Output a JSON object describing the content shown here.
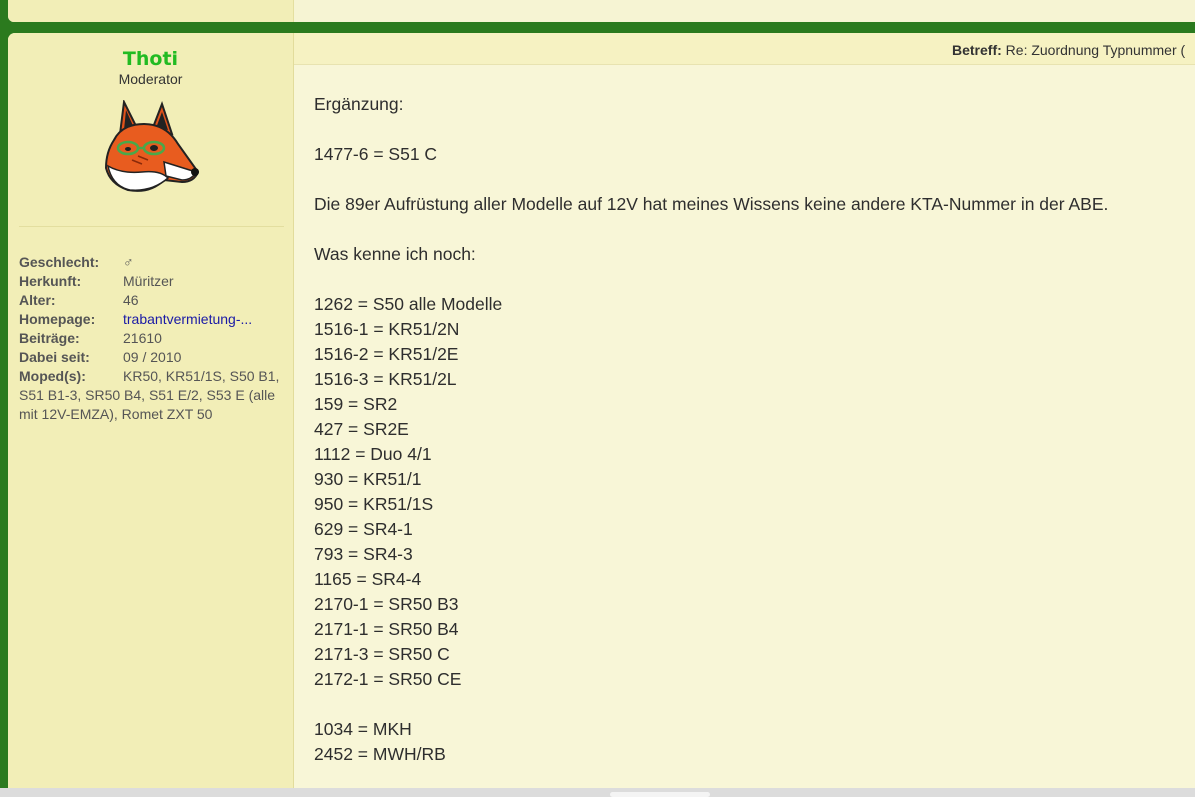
{
  "user": {
    "name": "Thoti",
    "title": "Moderator",
    "avatar": "fox-avatar"
  },
  "profile": [
    {
      "label": "Geschlecht:",
      "value": "♂"
    },
    {
      "label": "Herkunft:",
      "value": "Müritzer"
    },
    {
      "label": "Alter:",
      "value": "46"
    },
    {
      "label": "Homepage:",
      "value": "trabantvermietung-...",
      "link": true
    },
    {
      "label": "Beiträge:",
      "value": "21610"
    },
    {
      "label": "Dabei seit:",
      "value": "09 / 2010"
    }
  ],
  "mopeds": {
    "label": "Moped(s):",
    "value": "KR50, KR51/1S, S50 B1, S51 B1-3, SR50 B4, S51 E/2, S53 E (alle mit 12V-EMZA), Romet ZXT 50"
  },
  "subject": {
    "label": "Betreff:",
    "text": "Re: Zuordnung Typnummer ("
  },
  "message": {
    "intro": "Ergänzung:",
    "line1": "1477-6 = S51 C",
    "line2": "Die 89er Aufrüstung aller Modelle auf 12V hat meines Wissens keine andere KTA-Nummer in der ABE.",
    "line3": "Was kenne ich noch:",
    "list1": [
      "1262 = S50 alle Modelle",
      "1516-1 = KR51/2N",
      "1516-2 = KR51/2E",
      "1516-3 = KR51/2L",
      "159 = SR2",
      "427 = SR2E",
      "1112 = Duo 4/1",
      "930 = KR51/1",
      "950 = KR51/1S",
      "629 = SR4-1",
      "793 = SR4-3",
      "1165 = SR4-4",
      "2170-1 = SR50 B3",
      "2171-1 = SR50 B4",
      "2171-3 = SR50 C",
      "2172-1 = SR50 CE"
    ],
    "list2": [
      "1034 = MKH",
      "2452 = MWH/RB"
    ]
  },
  "colors": {
    "background_green": "#2b7a1e",
    "username_green": "#22bb22",
    "sidebar": "#f2eeb7",
    "post": "#f8f6d7",
    "link": "#1a1aa6"
  }
}
